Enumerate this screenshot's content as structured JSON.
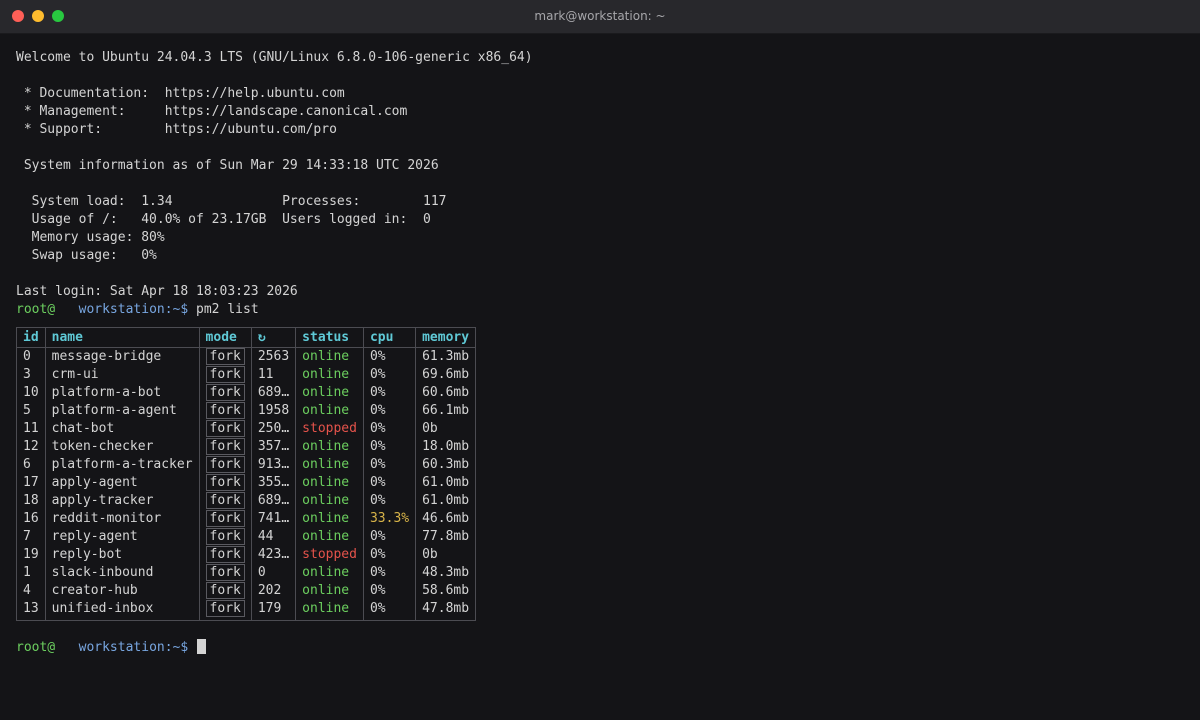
{
  "window": {
    "title": "mark@workstation: ~"
  },
  "motd": {
    "welcome": "Welcome to Ubuntu 24.04.3 LTS (GNU/Linux 6.8.0-106-generic x86_64)",
    "links": [
      " * Documentation:  https://help.ubuntu.com",
      " * Management:     https://landscape.canonical.com",
      " * Support:        https://ubuntu.com/pro"
    ],
    "sysinfo_header": " System information as of Sun Mar 29 14:33:18 UTC 2026",
    "sysinfo": [
      "  System load:  1.34              Processes:        117",
      "  Usage of /:   40.0% of 23.17GB  Users logged in:  0",
      "  Memory usage: 80%",
      "  Swap usage:   0%"
    ],
    "last_login": "Last login: Sat Apr 18 18:03:23 2026"
  },
  "prompt": {
    "user": "root@",
    "host": "workstation:~$",
    "command": " pm2 list"
  },
  "table": {
    "headers": [
      "id",
      "name",
      "mode",
      "↻",
      "status",
      "cpu",
      "memory"
    ],
    "rows": [
      {
        "id": "0",
        "name": "message-bridge",
        "mode": "fork",
        "restarts": "2563",
        "status": "online",
        "cpu": "0%",
        "memory": "61.3mb"
      },
      {
        "id": "3",
        "name": "crm-ui",
        "mode": "fork",
        "restarts": "11",
        "status": "online",
        "cpu": "0%",
        "memory": "69.6mb"
      },
      {
        "id": "10",
        "name": "platform-a-bot",
        "mode": "fork",
        "restarts": "689…",
        "status": "online",
        "cpu": "0%",
        "memory": "60.6mb"
      },
      {
        "id": "5",
        "name": "platform-a-agent",
        "mode": "fork",
        "restarts": "1958",
        "status": "online",
        "cpu": "0%",
        "memory": "66.1mb"
      },
      {
        "id": "11",
        "name": "chat-bot",
        "mode": "fork",
        "restarts": "250…",
        "status": "stopped",
        "cpu": "0%",
        "memory": "0b"
      },
      {
        "id": "12",
        "name": "token-checker",
        "mode": "fork",
        "restarts": "357…",
        "status": "online",
        "cpu": "0%",
        "memory": "18.0mb"
      },
      {
        "id": "6",
        "name": "platform-a-tracker",
        "mode": "fork",
        "restarts": "913…",
        "status": "online",
        "cpu": "0%",
        "memory": "60.3mb"
      },
      {
        "id": "17",
        "name": "apply-agent",
        "mode": "fork",
        "restarts": "355…",
        "status": "online",
        "cpu": "0%",
        "memory": "61.0mb"
      },
      {
        "id": "18",
        "name": "apply-tracker",
        "mode": "fork",
        "restarts": "689…",
        "status": "online",
        "cpu": "0%",
        "memory": "61.0mb"
      },
      {
        "id": "16",
        "name": "reddit-monitor",
        "mode": "fork",
        "restarts": "741…",
        "status": "online",
        "cpu": "33.3%",
        "memory": "46.6mb"
      },
      {
        "id": "7",
        "name": "reply-agent",
        "mode": "fork",
        "restarts": "44",
        "status": "online",
        "cpu": "0%",
        "memory": "77.8mb"
      },
      {
        "id": "19",
        "name": "reply-bot",
        "mode": "fork",
        "restarts": "423…",
        "status": "stopped",
        "cpu": "0%",
        "memory": "0b"
      },
      {
        "id": "1",
        "name": "slack-inbound",
        "mode": "fork",
        "restarts": "0",
        "status": "online",
        "cpu": "0%",
        "memory": "48.3mb"
      },
      {
        "id": "4",
        "name": "creator-hub",
        "mode": "fork",
        "restarts": "202",
        "status": "online",
        "cpu": "0%",
        "memory": "58.6mb"
      },
      {
        "id": "13",
        "name": "unified-inbox",
        "mode": "fork",
        "restarts": "179",
        "status": "online",
        "cpu": "0%",
        "memory": "47.8mb"
      }
    ]
  },
  "colors": {
    "background": "#141417",
    "online": "#6ccf5f",
    "stopped": "#e5534b",
    "header": "#5fc9d6",
    "prompt_host": "#78a6e0",
    "cpu_high": "#d8b449"
  }
}
